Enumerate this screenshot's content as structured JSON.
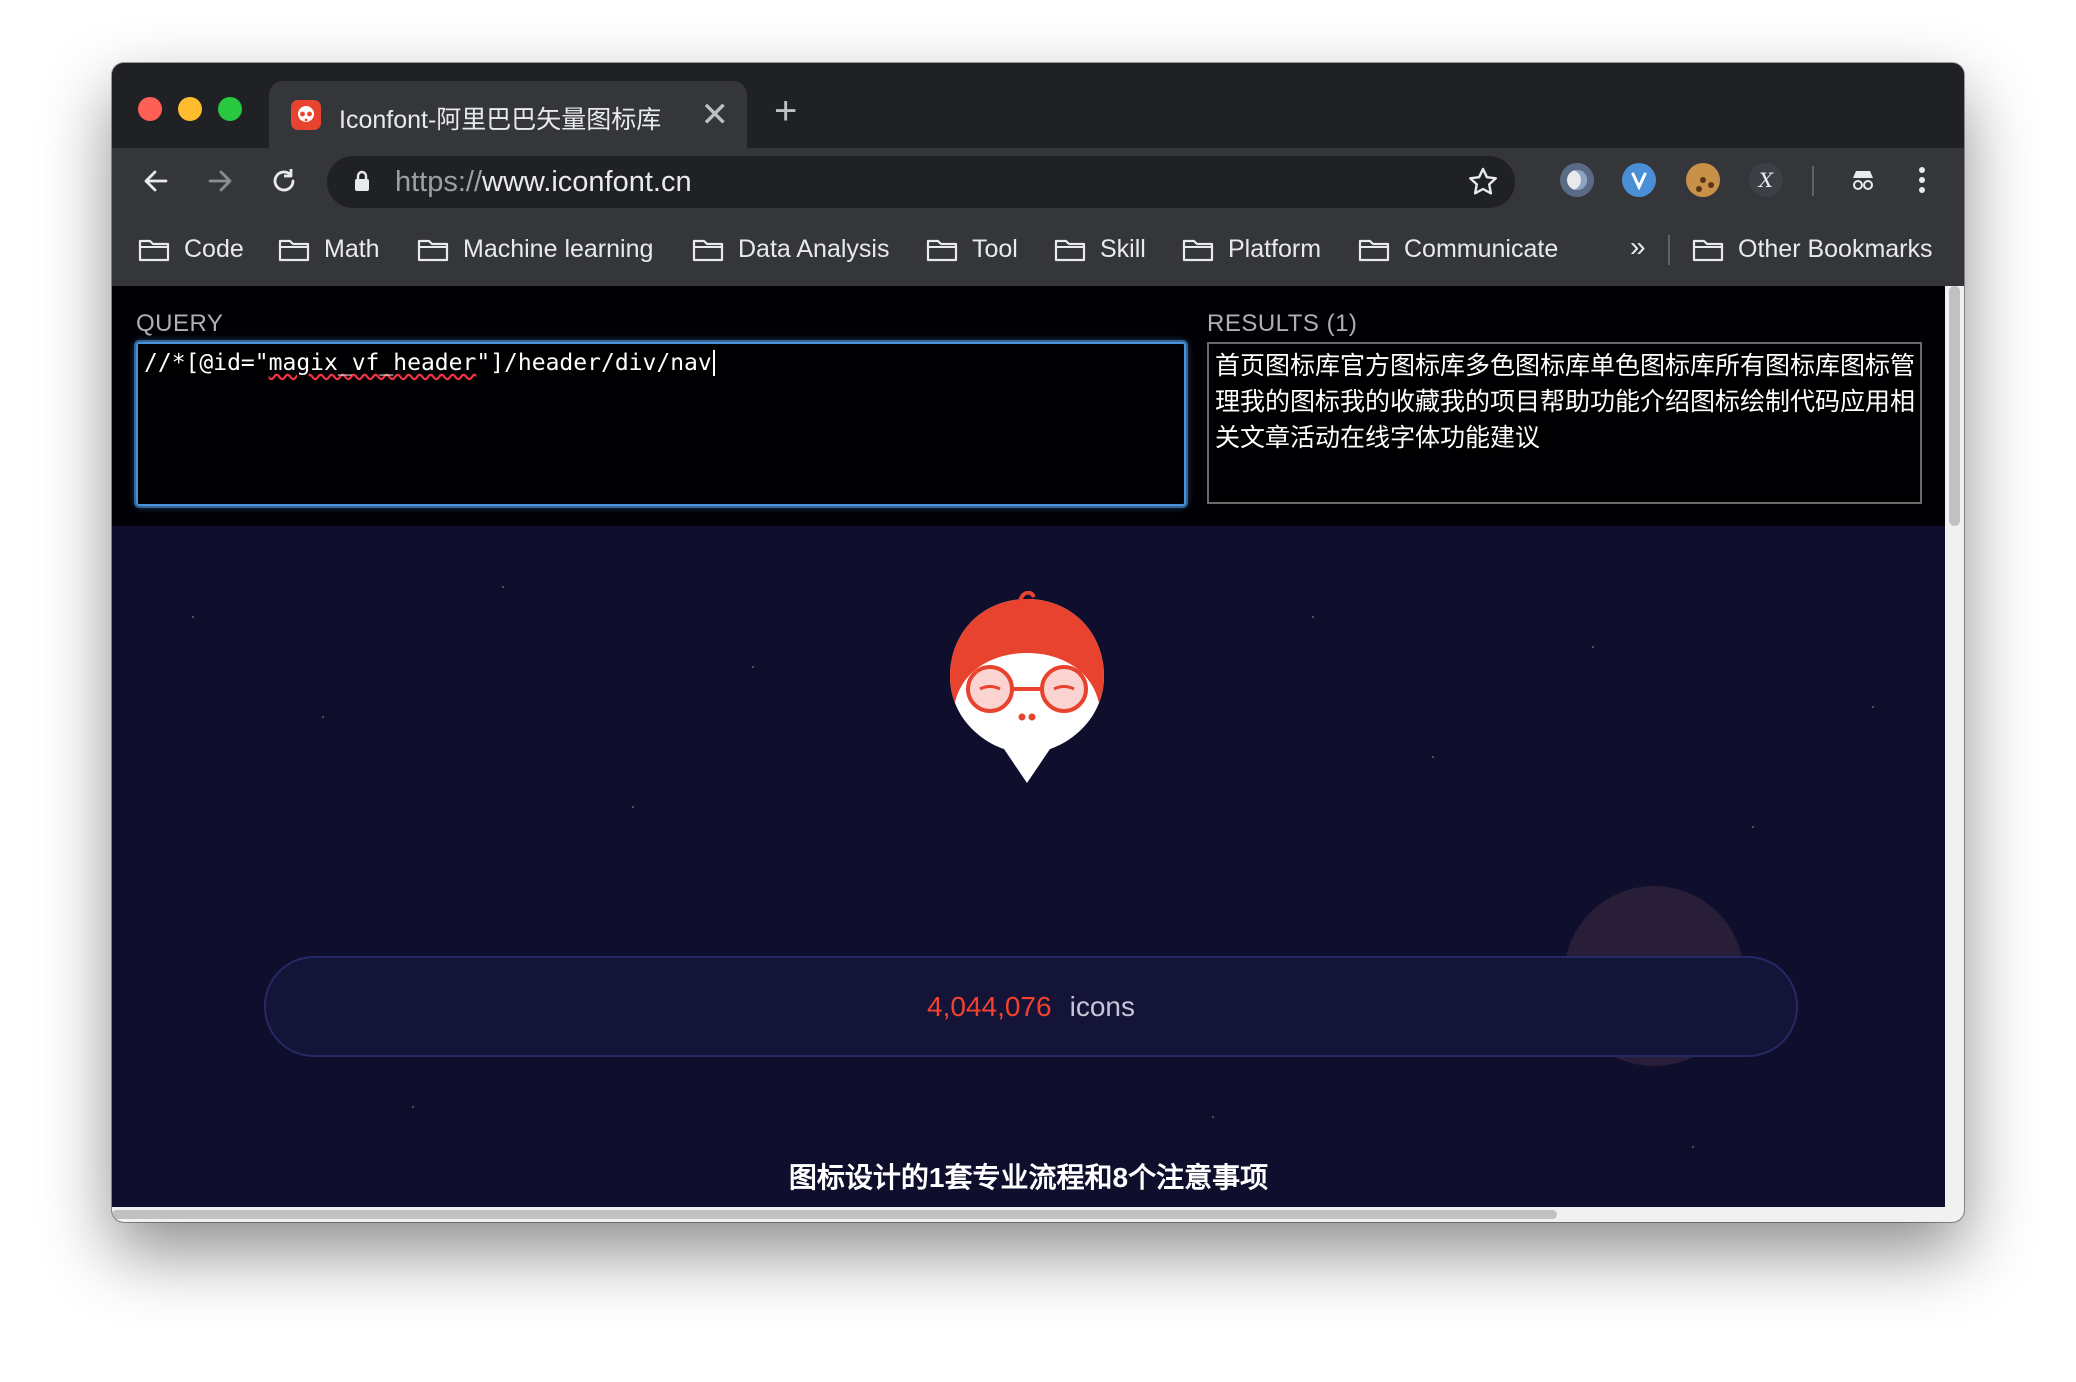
{
  "tab": {
    "title": "Iconfont-阿里巴巴矢量图标库",
    "close_glyph": "✕",
    "new_tab_glyph": "+"
  },
  "omnibox": {
    "scheme": "https://",
    "host": "www.iconfont.cn"
  },
  "bookmarks": [
    {
      "label": "Code"
    },
    {
      "label": "Math"
    },
    {
      "label": "Machine learning"
    },
    {
      "label": "Data Analysis"
    },
    {
      "label": "Tool"
    },
    {
      "label": "Skill"
    },
    {
      "label": "Platform"
    },
    {
      "label": "Communicate"
    }
  ],
  "bookmarks_overflow": "»",
  "other_bookmarks": "Other Bookmarks",
  "xpath": {
    "query_label": "QUERY",
    "query_before": "//*[@id=\"",
    "query_underlined": "magix_vf_header",
    "query_after": "\"]/header/div/nav",
    "results_label": "RESULTS (1)",
    "results_text": "首页图标库官方图标库多色图标库单色图标库所有图标库图标管理我的图标我的收藏我的项目帮助功能介绍图标绘制代码应用相关文章活动在线字体功能建议"
  },
  "page": {
    "icon_count": "4,044,076",
    "icon_label": "icons",
    "headline": "图标设计的1套专业流程和8个注意事项"
  },
  "colors": {
    "accent_red": "#f2422d",
    "page_bg": "#0f0e2c",
    "focus_blue": "#4a90d9"
  }
}
